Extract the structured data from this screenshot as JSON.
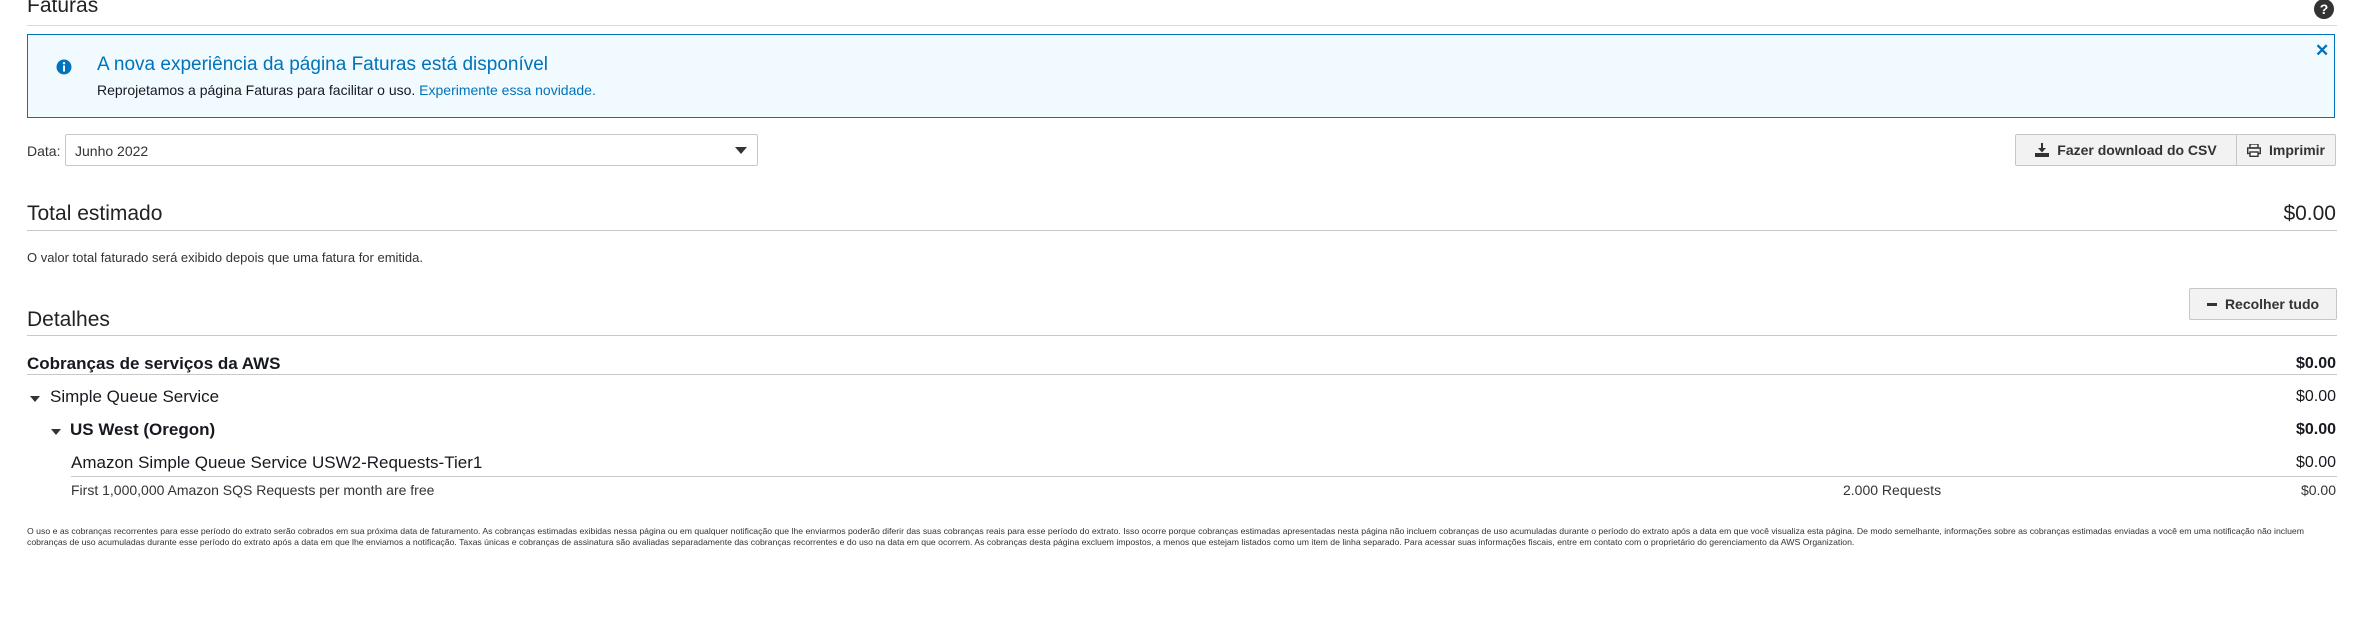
{
  "header": {
    "title": "Faturas",
    "help_icon": "help-circle-icon"
  },
  "banner": {
    "icon": "info-circle-icon",
    "title": "A nova experiência da página Faturas está disponível",
    "body": "Reprojetamos a página Faturas para facilitar o uso.",
    "link": "Experimente essa novidade.",
    "close_icon": "close-icon",
    "accent_color": "#0073bb",
    "background_color": "#f1faff"
  },
  "filter": {
    "label": "Data:",
    "selected": "Junho 2022"
  },
  "actions": {
    "download_csv": "Fazer download do CSV",
    "print": "Imprimir",
    "collapse_all": "Recolher tudo"
  },
  "total": {
    "title": "Total estimado",
    "value": "$0.00",
    "note": "O valor total faturado será exibido depois que uma fatura for emitida."
  },
  "details": {
    "title": "Detalhes",
    "service_charges": {
      "label": "Cobranças de serviços da AWS",
      "amount": "$0.00"
    },
    "service": {
      "label": "Simple Queue Service",
      "amount": "$0.00"
    },
    "region": {
      "label": "US West (Oregon)",
      "amount": "$0.00"
    },
    "item": {
      "label": "Amazon Simple Queue Service USW2-Requests-Tier1",
      "amount": "$0.00"
    },
    "usage": {
      "label": "First 1,000,000 Amazon SQS Requests per month are free",
      "quantity": "2.000 Requests",
      "amount": "$0.00"
    }
  },
  "disclaimer": "O uso e as cobranças recorrentes para esse período do extrato serão cobrados em sua próxima data de faturamento. As cobranças estimadas exibidas nessa página ou em qualquer notificação que lhe enviarmos poderão diferir das suas cobranças reais para esse período do extrato. Isso ocorre porque cobranças estimadas apresentadas nesta página não incluem cobranças de uso acumuladas durante o período do extrato após a data em que você visualiza esta página. De modo semelhante, informações sobre as cobranças estimadas enviadas a você em uma notificação não incluem cobranças de uso acumuladas durante esse período do extrato após a data em que lhe enviamos a notificação. Taxas únicas e cobranças de assinatura são avaliadas separadamente das cobranças recorrentes e do uso na data em que ocorrem. As cobranças desta página excluem impostos, a menos que estejam listados como um item de linha separado. Para acessar suas informações fiscais, entre em contato com o proprietário do gerenciamento da AWS Organization."
}
